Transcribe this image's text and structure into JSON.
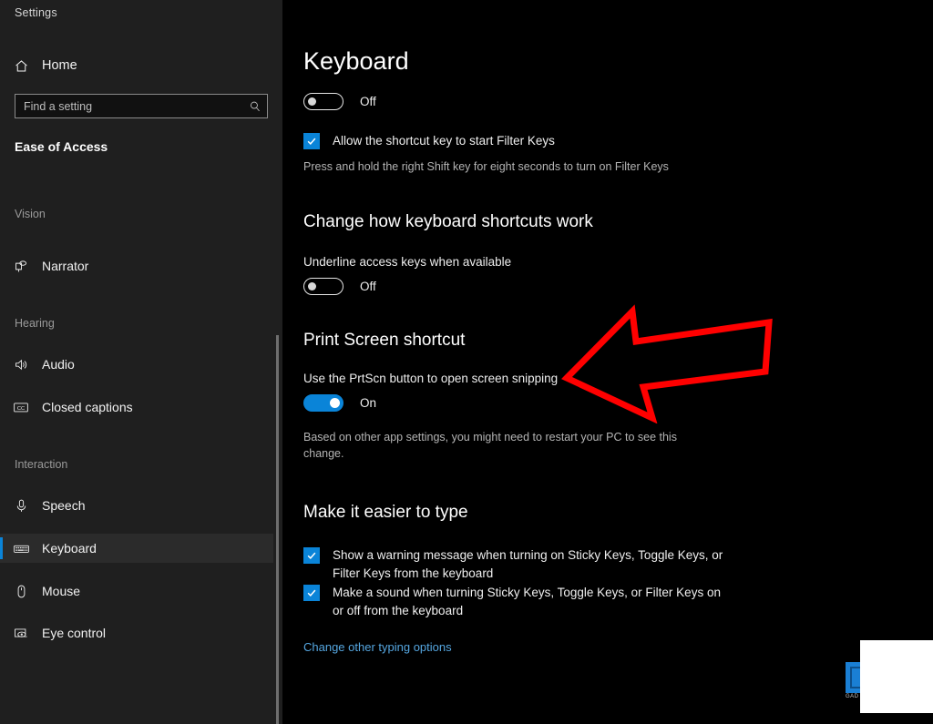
{
  "window": {
    "title": "Settings"
  },
  "sidebar": {
    "home": {
      "label": "Home",
      "icon": "home-icon"
    },
    "search": {
      "value": "",
      "placeholder": "Find a setting",
      "icon": "search-icon"
    },
    "category": "Ease of Access",
    "groups": [
      {
        "label": "Vision"
      },
      {
        "label": "Hearing"
      },
      {
        "label": "Interaction"
      }
    ],
    "items": [
      {
        "label": "Narrator",
        "icon": "narrator-icon",
        "selected": false
      },
      {
        "label": "Audio",
        "icon": "speaker-icon",
        "selected": false
      },
      {
        "label": "Closed captions",
        "icon": "closed-caption-icon",
        "selected": false
      },
      {
        "label": "Speech",
        "icon": "microphone-icon",
        "selected": false
      },
      {
        "label": "Keyboard",
        "icon": "keyboard-icon",
        "selected": true
      },
      {
        "label": "Mouse",
        "icon": "mouse-icon",
        "selected": false
      },
      {
        "label": "Eye control",
        "icon": "eye-control-icon",
        "selected": false
      }
    ]
  },
  "main": {
    "page_title": "Keyboard",
    "keyboard_toggle": {
      "state": "Off",
      "on": false
    },
    "filter_keys_checkbox": {
      "label": "Allow the shortcut key to start Filter Keys",
      "checked": true
    },
    "filter_keys_description": "Press and hold the right Shift key for eight seconds to turn on Filter Keys",
    "shortcuts_section": {
      "heading": "Change how keyboard shortcuts work",
      "underline_label": "Underline access keys when available",
      "underline_toggle": {
        "state": "Off",
        "on": false
      }
    },
    "print_screen_section": {
      "heading": "Print Screen shortcut",
      "label": "Use the PrtScn button to open screen snipping",
      "toggle": {
        "state": "On",
        "on": true
      },
      "description": "Based on other app settings, you might need to restart your PC to see this change."
    },
    "type_section": {
      "heading": "Make it easier to type",
      "checkboxes": [
        {
          "label": "Show a warning message when turning on Sticky Keys, Toggle Keys, or Filter Keys from the keyboard",
          "checked": true
        },
        {
          "label": "Make a sound when turning Sticky Keys, Toggle Keys, or Filter Keys on or off from the keyboard",
          "checked": true
        }
      ],
      "link": "Change other typing options"
    }
  },
  "annotation": {
    "type": "arrow",
    "direction": "left",
    "color": "#ff0000",
    "points_at": "Use the PrtScn button to open screen snipping"
  },
  "corner_widget": {
    "caption": "GAD",
    "icon": "blue-badge-icon"
  },
  "colors": {
    "accent": "#0a84d8",
    "sidebar_bg": "#1f1f1f",
    "main_bg": "#000000",
    "link": "#55a6e0",
    "annotation": "#ff0000"
  }
}
